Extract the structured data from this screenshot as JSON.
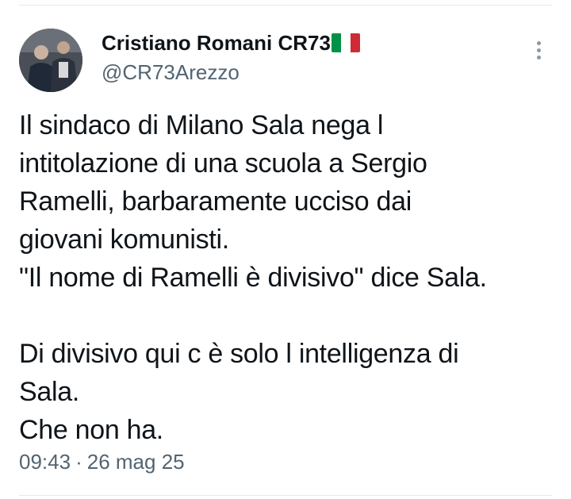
{
  "author": {
    "name": "Cristiano Romani CR73",
    "handle": "@CR73Arezzo",
    "flag_icon": "italy-flag-icon",
    "flag_colors": [
      "#009246",
      "#ffffff",
      "#ce2b37"
    ]
  },
  "menu": {
    "icon": "more-vertical-icon"
  },
  "tweet": {
    "lines": [
      "Il sindaco di Milano Sala nega l",
      "intitolazione di una scuola a Sergio",
      "Ramelli, barbaramente ucciso dai",
      "giovani komunisti.",
      "\"Il nome di Ramelli è divisivo\" dice Sala.",
      "",
      "Di divisivo qui c è solo l intelligenza di",
      "Sala.",
      "Che non ha."
    ]
  },
  "meta": {
    "time": "09:43",
    "separator": "·",
    "date": "26 mag 25"
  },
  "colors": {
    "text": "#0f1419",
    "secondary": "#536471",
    "divider": "#e6e9eb"
  }
}
